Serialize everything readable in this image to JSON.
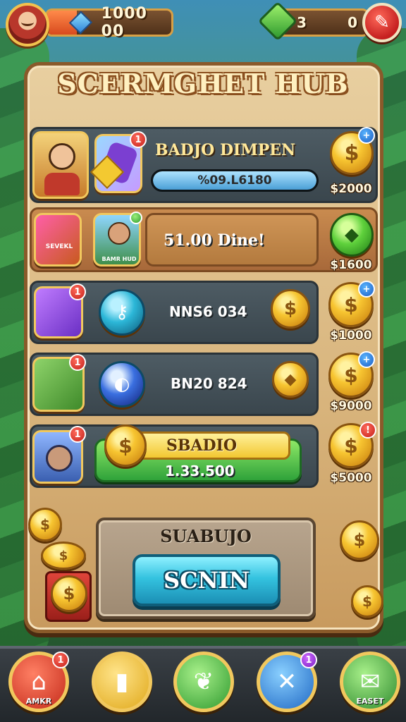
{
  "topbar": {
    "coins_display": "1000 00",
    "gems_left": "3",
    "gems_right": "0"
  },
  "title": "SCERMGHET HUB",
  "rows": [
    {
      "name": "BADJO DIMPEN",
      "progress_text": "%09.L6180",
      "price": "$2000"
    },
    {
      "icon_label": "SEVEKL",
      "portrait_label": "BAMR HUD",
      "name": "51.00 Dine!",
      "price": "$1600"
    },
    {
      "name": "NNS6 034",
      "price": "$1000"
    },
    {
      "name": "BN20 824",
      "price": "$9000"
    },
    {
      "name": "SBADIO",
      "value": "1.33.500",
      "price": "$5000"
    }
  ],
  "footer": {
    "subtitle": "SUABUJO",
    "scan_label": "SCNIN"
  },
  "nav": [
    {
      "label": "AMKR",
      "icon": "home-icon"
    },
    {
      "label": "",
      "icon": "card-icon"
    },
    {
      "label": "",
      "icon": "feather-icon"
    },
    {
      "label": "",
      "icon": "cross-tools-icon"
    },
    {
      "label": "EASET",
      "icon": "inbox-icon"
    }
  ],
  "badges": {
    "row1_card": "1",
    "row2_card": "1",
    "row3_icon": "1",
    "row4_icon": "1",
    "row5_icon": "1",
    "nav_home": "1",
    "nav_tools": "1"
  },
  "colors": {
    "panel": "#d8b47c",
    "panel_border": "#8a5a2a",
    "scan_button": "#34c3e0",
    "gold": "#f7c531"
  }
}
